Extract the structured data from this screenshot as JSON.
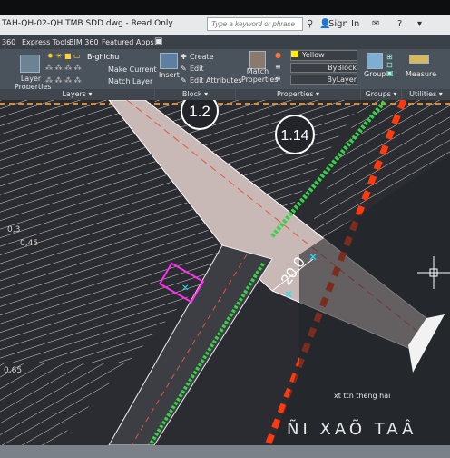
{
  "titlebar": {
    "file": "TAH-QH-02-QH TMB SDD.dwg - Read Only",
    "search_placeholder": "Type a keyword or phrase",
    "signin": "Sign In"
  },
  "menu": {
    "items": [
      "360",
      "Express Tools",
      "BIM 360",
      "Featured Apps"
    ]
  },
  "ribbon": {
    "layer_properties": "Layer Properties",
    "layer_name": "B-ghichu",
    "make_current": "Make Current",
    "match_layer": "Match Layer",
    "insert": "Insert",
    "create": "Create",
    "edit": "Edit",
    "edit_attributes": "Edit Attributes",
    "match_properties": "Match Properties",
    "color": "Yellow",
    "byblock": "ByBlock",
    "bylayer": "ByLayer",
    "group": "Group",
    "measure": "Measure",
    "groups": {
      "layers": "Layers",
      "block": "Block",
      "properties": "Properties",
      "groups": "Groups",
      "utilities": "Utilities"
    }
  },
  "drawing": {
    "circle_labels": [
      "1.2",
      "1.14"
    ],
    "dimension": "20.0",
    "street_label": "xt ttn theng hai",
    "bottom_text": "ÑI XAÕ TAÂ",
    "left_texts": [
      "0,3",
      "0,45",
      "0,65"
    ]
  },
  "colors": {
    "road": "#c9b9b6",
    "green": "#39d14a",
    "red": "#ff3a0f",
    "hatch": "#d9d3cc",
    "dark": "#2a2c31"
  }
}
